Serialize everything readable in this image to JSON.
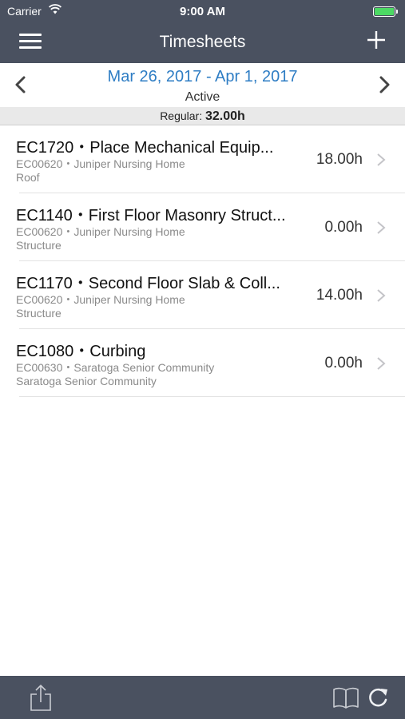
{
  "status_bar": {
    "carrier": "Carrier",
    "time": "9:00 AM",
    "battery_level": 1.0
  },
  "nav": {
    "title": "Timesheets"
  },
  "period": {
    "date_range": "Mar 26, 2017 - Apr 1, 2017",
    "status": "Active",
    "summary_label": "Regular: ",
    "summary_value": "32.00h"
  },
  "entries": [
    {
      "title": "EC1720・Place Mechanical Equip...",
      "subtitle": "EC00620・Juniper Nursing Home",
      "location": "Roof",
      "hours": "18.00h"
    },
    {
      "title": "EC1140・First Floor Masonry Struct...",
      "subtitle": "EC00620・Juniper Nursing Home",
      "location": "Structure",
      "hours": "0.00h"
    },
    {
      "title": "EC1170・Second Floor Slab & Coll...",
      "subtitle": "EC00620・Juniper Nursing Home",
      "location": "Structure",
      "hours": "14.00h"
    },
    {
      "title": "EC1080・Curbing",
      "subtitle": "EC00630・Saratoga Senior Community",
      "location": "Saratoga Senior Community",
      "hours": "0.00h"
    }
  ],
  "icons": {
    "menu": "hamburger-icon",
    "add": "plus-icon",
    "prev": "chevron-left-icon",
    "next": "chevron-right-icon",
    "share": "share-icon",
    "book": "book-icon",
    "refresh": "refresh-icon",
    "wifi": "wifi-icon"
  },
  "colors": {
    "bar": "#4a5160",
    "accent": "#2e7dc4",
    "battery": "#4cd964"
  }
}
